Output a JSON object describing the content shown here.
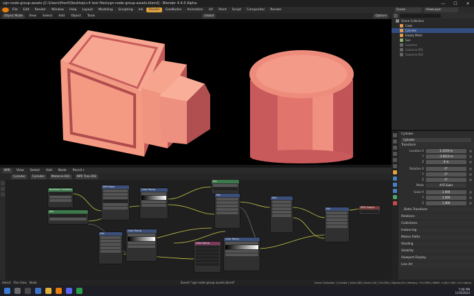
{
  "window": {
    "title": "vgn-node-group-assets [C:\\Users\\fhonf\\Desktop\\+4 test files\\vgn-node-group-assets.blend] - Blender 4.4.0 Alpha",
    "minimize": "—",
    "maximize": "☐",
    "close": "✕"
  },
  "menu": {
    "items": [
      "File",
      "Edit",
      "Render",
      "Window",
      "Help"
    ],
    "workspaces": [
      "Layout",
      "Modeling",
      "Sculpting",
      "Ink",
      "Shader",
      "GeoNodes",
      "Animation",
      "UV",
      "Paint",
      "Script",
      "Compositor",
      "Render"
    ],
    "active_workspace": "Shader",
    "scene_label": "Scene",
    "view_layer_label": "ViewLayer"
  },
  "viewport_header": {
    "mode": "Object Mode",
    "items": [
      "View",
      "Select",
      "Add",
      "Object",
      "Tools"
    ],
    "orientation": "Global",
    "options": "Options"
  },
  "node_header": {
    "editor": "NPR",
    "items": [
      "View",
      "Select",
      "Add",
      "Node",
      "Pencil+"
    ],
    "object": "Cylinder",
    "slot": "Cylinder",
    "material": "Material.002",
    "tree": "NPR Tree.002"
  },
  "nodes": [
    {
      "title": "Backface Condition"
    },
    {
      "title": "Mix"
    },
    {
      "title": "NPR Mask"
    },
    {
      "title": "Color Ramp"
    },
    {
      "title": "Color Ramp"
    },
    {
      "title": "Mix"
    },
    {
      "title": "Mix"
    },
    {
      "title": "Mix"
    },
    {
      "title": "Add"
    },
    {
      "title": "Color Ramp"
    },
    {
      "title": "NPR Output"
    },
    {
      "title": "Mix"
    },
    {
      "title": "Color Ramp"
    },
    {
      "title": "Emission"
    },
    {
      "title": "Color Ramp"
    },
    {
      "title": "Mix"
    },
    {
      "title": "Geometry"
    },
    {
      "title": "Mix"
    }
  ],
  "outliner": {
    "header": "Scene Collection",
    "items": [
      {
        "label": "Scene Collection",
        "color": "#8a8a8a"
      },
      {
        "label": "Cube",
        "color": "#e09a4c"
      },
      {
        "label": "Cylinder",
        "color": "#e09a4c"
      },
      {
        "label": "Empty Mesh",
        "color": "#e09a4c"
      },
      {
        "label": "Sun",
        "color": "#8fb26b"
      },
      {
        "label": "Suzanne",
        "color": "#666666"
      },
      {
        "label": "Suzanne.001",
        "color": "#666666"
      },
      {
        "label": "Suzanne.002",
        "color": "#666666"
      }
    ]
  },
  "properties": {
    "object_name": "Cylinder",
    "object_field": "Cylinder",
    "transform_label": "Transform",
    "location": {
      "label": "Location X",
      "x": "3.1919 m",
      "y_label": "Y",
      "y": "-3.8214 m",
      "z_label": "Z",
      "z": "0 m"
    },
    "rotation": {
      "label": "Rotation X",
      "x": "0°",
      "y_label": "Y",
      "y": "0°",
      "z_label": "Z",
      "z": "0°"
    },
    "mode": {
      "label": "Mode",
      "value": "XYZ Euler"
    },
    "scale": {
      "label": "Scale X",
      "x": "1.000",
      "y_label": "Y",
      "y": "1.000",
      "z_label": "Z",
      "z": "1.000"
    },
    "sections": [
      "Delta Transform",
      "Relations",
      "Collections",
      "Instancing",
      "Motion Paths",
      "Shading",
      "Visibility",
      "Viewport Display",
      "Line Art"
    ]
  },
  "status": {
    "left": [
      "Select",
      "Pan View",
      "Node"
    ],
    "message": "Saved \"vgn-node-group-assets.blend\"",
    "right": "Scene Collection | Cylinder | Verts:168 | Faces:140 | Tris:348 | Objects:0/4 | Memory: 79.4 MiB | VRAM: 1.4/8.0 GiB | 4.4.0 Alpha"
  },
  "taskbar": {
    "time": "7:00 PM",
    "date": "11/9/2024"
  },
  "colors": {
    "accent": "#e1a341",
    "selection": "#334d80",
    "object_salmon": "#f08a78"
  }
}
